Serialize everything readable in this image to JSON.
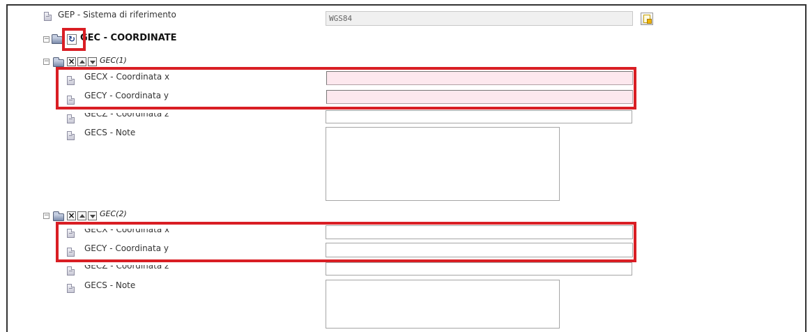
{
  "gep": {
    "label": "GEP - Sistema di riferimento",
    "value": "WGS84",
    "lookup_icon": "lookup-icon"
  },
  "gec": {
    "title": "GEC - COORDINATE",
    "refresh_icon": "refresh-icon",
    "instances": [
      {
        "title": "GEC(1)",
        "fields": {
          "x_label": "GECX - Coordinata x",
          "y_label": "GECY - Coordinata y",
          "z_label": "GECZ - Coordinata z",
          "note_label": "GECS - Note",
          "x_value": "",
          "y_value": "",
          "z_value": "",
          "note_value": ""
        }
      },
      {
        "title": "GEC(2)",
        "fields": {
          "x_label": "GECX - Coordinata x",
          "y_label": "GECY - Coordinata y",
          "z_label": "GECZ - Coordinata z",
          "note_label": "GECS - Note",
          "x_value": "",
          "y_value": "",
          "z_value": "",
          "note_value": ""
        }
      }
    ]
  },
  "colors": {
    "highlight": "#d91e24",
    "required_field_bg": "#fde8ee",
    "readonly_field_bg": "#f0f0f0"
  },
  "icons": {
    "tree_toggle": "minus",
    "delete": "x",
    "move_up": "arrow-up",
    "move_down": "arrow-down",
    "folder": "folder-open",
    "field": "document"
  }
}
